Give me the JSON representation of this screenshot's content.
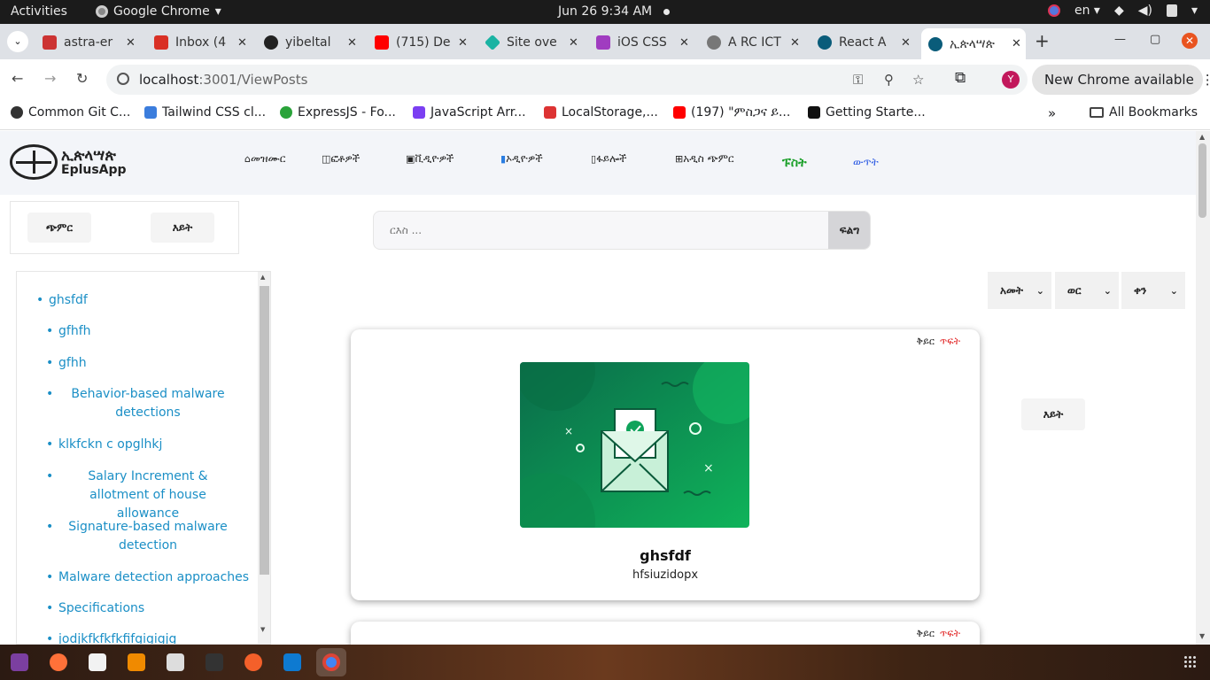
{
  "system": {
    "activities": "Activities",
    "app": "Google Chrome",
    "app_caret": "▾",
    "clock": "Jun 26  9:34 AM",
    "lang": "en ▾"
  },
  "tabs": [
    {
      "label": "astra-er",
      "color": "#c33"
    },
    {
      "label": "Inbox (4",
      "color": "#d93025"
    },
    {
      "label": "yibeltal",
      "color": "#222"
    },
    {
      "label": "(715) De",
      "color": "#f00"
    },
    {
      "label": "Site ove",
      "color": "#1ab3a3"
    },
    {
      "label": "iOS CSS",
      "color": "#a03cc0"
    },
    {
      "label": "A RC ICT",
      "color": "#777"
    },
    {
      "label": "React A",
      "color": "#0a5c7a"
    },
    {
      "label": "ኢጵላሣጵ",
      "color": "#0a5c7a"
    }
  ],
  "browser": {
    "url_host": "localhost",
    "url_path": ":3001/ViewPosts",
    "new_chrome": "New Chrome available",
    "avatar": "Y"
  },
  "bookmarks": [
    "Common Git C...",
    "Tailwind CSS cl...",
    "ExpressJS - Fo...",
    "JavaScript Arr...",
    "LocalStorage,...",
    "(197) \"ምስጋና ይ...",
    "Getting Starte..."
  ],
  "bookmarks_more": "»",
  "bookmarks_all": "All Bookmarks",
  "brand": {
    "line1": "ኢጵላሣጵ",
    "line2": "EplusApp"
  },
  "nav": {
    "music": "መዝሙር",
    "images": "ፎቶዎች",
    "videos": "ቪዲዮዎች",
    "audio": "ኦዲዮዎች",
    "files": "ፋይሎች",
    "new_add": "አዲስ ጭምር",
    "post": "ፑስት",
    "logout": "ውጥት"
  },
  "side": {
    "add_btn": "ጭምር",
    "view_btn": "እይት"
  },
  "search": {
    "placeholder": "ርእስ ...",
    "button": "ፍልግ"
  },
  "side_items": [
    "ghsfdf",
    "gfhfh",
    "gfhh",
    "Behavior-based malware detections",
    "klkfckn c opglhkj",
    "Salary Increment & allotment of house allowance",
    "Signature-based malware detection",
    "Malware detection approaches",
    "Specifications",
    "jodjkfkfkfkfifgigigjg"
  ],
  "filters": {
    "year": "አመት",
    "month": "ወር",
    "day": "ቀን"
  },
  "post": {
    "edit": "ቅይር",
    "delete": "ጥፍት",
    "title": "ghsfdf",
    "desc": "hfsiuzidopx"
  },
  "post2": {
    "edit": "ቅይር",
    "delete": "ጥፍት"
  },
  "right_view": "እይት",
  "colors": {
    "post_accent": "#1a9f29",
    "logout_accent": "#2d5be3",
    "link": "#1b8fc6",
    "delete": "#e02020",
    "close": "#e95420"
  }
}
